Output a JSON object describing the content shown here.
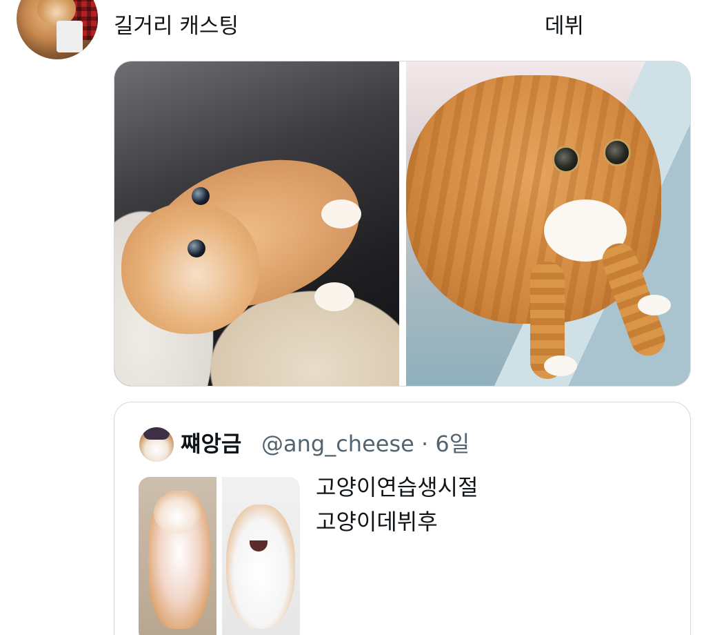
{
  "tweet": {
    "body_left": "길거리 캐스팅",
    "body_right": "데뷔"
  },
  "quote": {
    "display_name": "쨰앙금",
    "handle_time": "@ang_cheese · 6일",
    "lines": [
      "고양이연습생시절",
      "고양이데뷔후"
    ]
  }
}
